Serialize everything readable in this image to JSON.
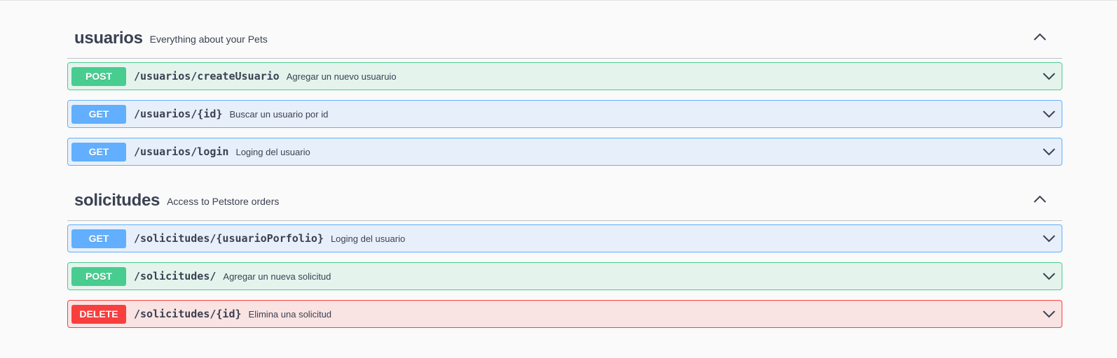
{
  "sections": [
    {
      "name": "usuarios",
      "description": "Everything about your Pets",
      "operations": [
        {
          "method": "POST",
          "path": "/usuarios/createUsuario",
          "summary": "Agregar un nuevo usuaruio"
        },
        {
          "method": "GET",
          "path": "/usuarios/{id}",
          "summary": "Buscar un usuario por id"
        },
        {
          "method": "GET",
          "path": "/usuarios/login",
          "summary": "Loging del usuario"
        }
      ]
    },
    {
      "name": "solicitudes",
      "description": "Access to Petstore orders",
      "operations": [
        {
          "method": "GET",
          "path": "/solicitudes/{usuarioPorfolio}",
          "summary": "Loging del usuario"
        },
        {
          "method": "POST",
          "path": "/solicitudes/",
          "summary": "Agregar un nueva solicitud"
        },
        {
          "method": "DELETE",
          "path": "/solicitudes/{id}",
          "summary": "Elimina una solicitud"
        }
      ]
    }
  ],
  "icons": {
    "section_toggle": "chevron-up-icon",
    "operation_toggle": "chevron-down-icon"
  },
  "colors": {
    "post": "#49cc90",
    "get": "#61affe",
    "delete": "#f93e3e",
    "text": "#3b4151"
  }
}
